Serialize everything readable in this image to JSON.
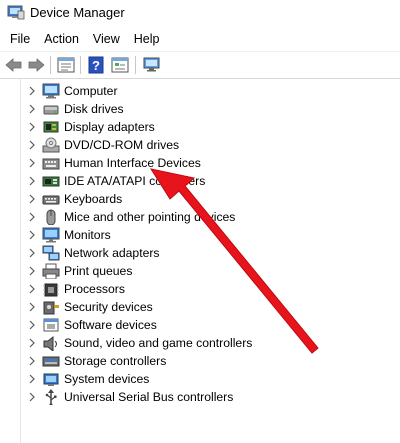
{
  "window": {
    "title": "Device Manager"
  },
  "menu": [
    "File",
    "Action",
    "View",
    "Help"
  ],
  "toolbar": {
    "buttons": [
      {
        "name": "back-icon"
      },
      {
        "name": "forward-icon"
      },
      {
        "name": "properties-icon"
      },
      {
        "name": "help-icon"
      },
      {
        "name": "update-driver-icon"
      },
      {
        "name": "monitor-scan-icon"
      }
    ]
  },
  "tree": {
    "items": [
      {
        "label": "Computer",
        "icon": "computer-icon"
      },
      {
        "label": "Disk drives",
        "icon": "disk-drive-icon"
      },
      {
        "label": "Display adapters",
        "icon": "display-adapter-icon"
      },
      {
        "label": "DVD/CD-ROM drives",
        "icon": "dvd-drive-icon"
      },
      {
        "label": "Human Interface Devices",
        "icon": "hid-icon"
      },
      {
        "label": "IDE ATA/ATAPI controllers",
        "icon": "ide-controller-icon"
      },
      {
        "label": "Keyboards",
        "icon": "keyboard-icon"
      },
      {
        "label": "Mice and other pointing devices",
        "icon": "mouse-icon"
      },
      {
        "label": "Monitors",
        "icon": "monitor-icon"
      },
      {
        "label": "Network adapters",
        "icon": "network-adapter-icon"
      },
      {
        "label": "Print queues",
        "icon": "printer-icon"
      },
      {
        "label": "Processors",
        "icon": "processor-icon"
      },
      {
        "label": "Security devices",
        "icon": "security-device-icon"
      },
      {
        "label": "Software devices",
        "icon": "software-device-icon"
      },
      {
        "label": "Sound, video and game controllers",
        "icon": "speaker-icon"
      },
      {
        "label": "Storage controllers",
        "icon": "storage-controller-icon"
      },
      {
        "label": "System devices",
        "icon": "system-device-icon"
      },
      {
        "label": "Universal Serial Bus controllers",
        "icon": "usb-icon"
      }
    ]
  },
  "annotation": {
    "type": "red-arrow",
    "target": "Human Interface Devices",
    "color": "#e8141c"
  }
}
